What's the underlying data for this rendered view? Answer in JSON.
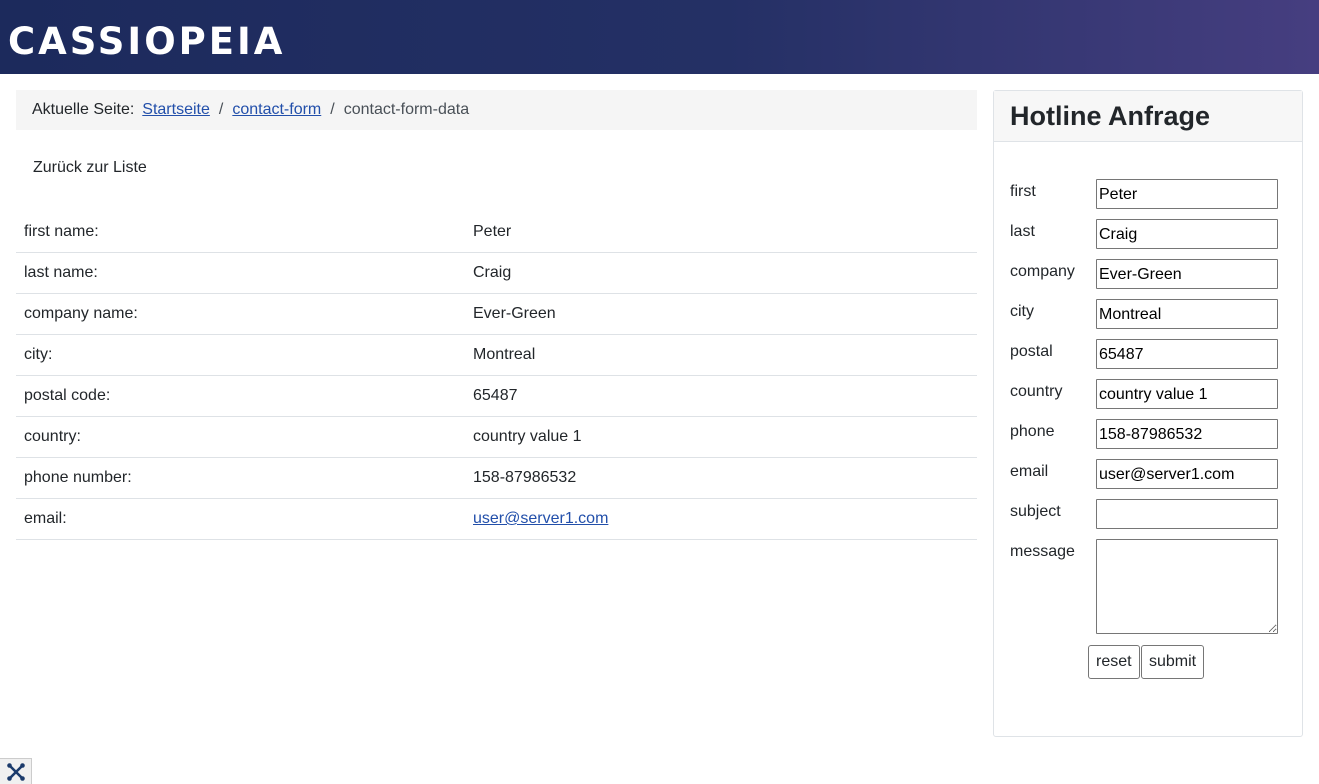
{
  "header": {
    "brand": "CASSIOPEIA"
  },
  "breadcrumb": {
    "lead": "Aktuelle Seite:",
    "items": [
      "Startseite",
      "contact-form"
    ],
    "separator": "/",
    "current": "contact-form-data"
  },
  "main": {
    "back_link": "Zurück zur Liste",
    "rows": [
      {
        "label": "first name:",
        "value": "Peter"
      },
      {
        "label": "last name:",
        "value": "Craig"
      },
      {
        "label": "company name:",
        "value": "Ever-Green"
      },
      {
        "label": "city:",
        "value": "Montreal"
      },
      {
        "label": "postal code:",
        "value": "65487"
      },
      {
        "label": "country:",
        "value": "country value 1"
      },
      {
        "label": "phone number:",
        "value": "158-87986532"
      },
      {
        "label": "email:",
        "value": "user@server1.com"
      }
    ]
  },
  "sidebar": {
    "title": "Hotline Anfrage",
    "fields": [
      {
        "label": "first",
        "value": "Peter"
      },
      {
        "label": "last",
        "value": "Craig"
      },
      {
        "label": "company",
        "value": "Ever-Green"
      },
      {
        "label": "city",
        "value": "Montreal"
      },
      {
        "label": "postal",
        "value": "65487"
      },
      {
        "label": "country",
        "value": "country value 1"
      },
      {
        "label": "phone",
        "value": "158-87986532"
      },
      {
        "label": "email",
        "value": "user@server1.com"
      },
      {
        "label": "subject",
        "value": ""
      },
      {
        "label": "message",
        "value": ""
      }
    ],
    "reset_label": "reset",
    "submit_label": "submit"
  },
  "footer": {
    "badge_icon": "joomla-icon"
  },
  "colors": {
    "header_start": "#1c2a5c",
    "header_end": "#463e80",
    "link": "#224faa"
  }
}
